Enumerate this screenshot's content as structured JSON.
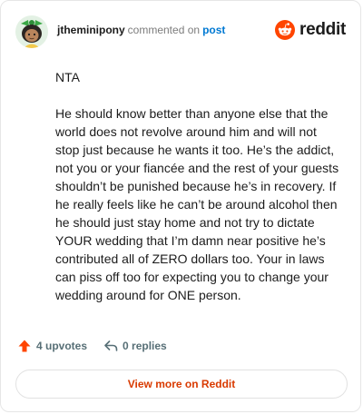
{
  "header": {
    "username": "jtheminipony",
    "commented_text": "commented on",
    "post_link": "post",
    "brand": "reddit"
  },
  "comment": {
    "paragraphs": [
      "NTA",
      "He should know better than anyone else that the world does not revolve around him and will not stop just because he wants it too. He’s the addict, not you or your fiancée and the rest of your guests shouldn’t be punished because he’s in recovery. If he really feels like he can’t be around alcohol then he should just stay home and not try to dictate YOUR wedding that I’m damn near positive he’s contributed all of ZERO dollars too. Your in laws can piss off too for expecting you to change your wedding around for ONE person."
    ]
  },
  "actions": {
    "upvotes": "4 upvotes",
    "replies": "0 replies"
  },
  "footer": {
    "view_more": "View more on Reddit"
  },
  "icons": {
    "brand_icon": "reddit-snoo-icon",
    "upvote_icon": "upvote-arrow-icon",
    "reply_icon": "reply-arrow-icon"
  },
  "colors": {
    "accent": "#ff4500",
    "link": "#0079d3",
    "view_more_text": "#d93a00",
    "muted": "#576f76"
  }
}
